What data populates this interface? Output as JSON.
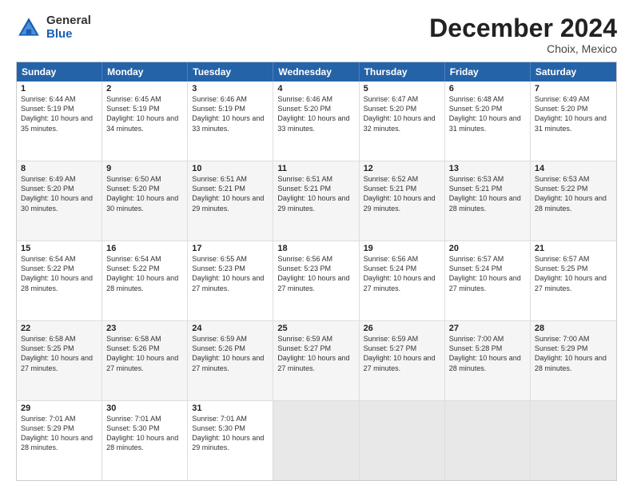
{
  "logo": {
    "general": "General",
    "blue": "Blue"
  },
  "title": "December 2024",
  "subtitle": "Choix, Mexico",
  "days_of_week": [
    "Sunday",
    "Monday",
    "Tuesday",
    "Wednesday",
    "Thursday",
    "Friday",
    "Saturday"
  ],
  "weeks": [
    [
      {
        "day": "1",
        "sunrise": "Sunrise: 6:44 AM",
        "sunset": "Sunset: 5:19 PM",
        "daylight": "Daylight: 10 hours and 35 minutes."
      },
      {
        "day": "2",
        "sunrise": "Sunrise: 6:45 AM",
        "sunset": "Sunset: 5:19 PM",
        "daylight": "Daylight: 10 hours and 34 minutes."
      },
      {
        "day": "3",
        "sunrise": "Sunrise: 6:46 AM",
        "sunset": "Sunset: 5:19 PM",
        "daylight": "Daylight: 10 hours and 33 minutes."
      },
      {
        "day": "4",
        "sunrise": "Sunrise: 6:46 AM",
        "sunset": "Sunset: 5:20 PM",
        "daylight": "Daylight: 10 hours and 33 minutes."
      },
      {
        "day": "5",
        "sunrise": "Sunrise: 6:47 AM",
        "sunset": "Sunset: 5:20 PM",
        "daylight": "Daylight: 10 hours and 32 minutes."
      },
      {
        "day": "6",
        "sunrise": "Sunrise: 6:48 AM",
        "sunset": "Sunset: 5:20 PM",
        "daylight": "Daylight: 10 hours and 31 minutes."
      },
      {
        "day": "7",
        "sunrise": "Sunrise: 6:49 AM",
        "sunset": "Sunset: 5:20 PM",
        "daylight": "Daylight: 10 hours and 31 minutes."
      }
    ],
    [
      {
        "day": "8",
        "sunrise": "Sunrise: 6:49 AM",
        "sunset": "Sunset: 5:20 PM",
        "daylight": "Daylight: 10 hours and 30 minutes."
      },
      {
        "day": "9",
        "sunrise": "Sunrise: 6:50 AM",
        "sunset": "Sunset: 5:20 PM",
        "daylight": "Daylight: 10 hours and 30 minutes."
      },
      {
        "day": "10",
        "sunrise": "Sunrise: 6:51 AM",
        "sunset": "Sunset: 5:21 PM",
        "daylight": "Daylight: 10 hours and 29 minutes."
      },
      {
        "day": "11",
        "sunrise": "Sunrise: 6:51 AM",
        "sunset": "Sunset: 5:21 PM",
        "daylight": "Daylight: 10 hours and 29 minutes."
      },
      {
        "day": "12",
        "sunrise": "Sunrise: 6:52 AM",
        "sunset": "Sunset: 5:21 PM",
        "daylight": "Daylight: 10 hours and 29 minutes."
      },
      {
        "day": "13",
        "sunrise": "Sunrise: 6:53 AM",
        "sunset": "Sunset: 5:21 PM",
        "daylight": "Daylight: 10 hours and 28 minutes."
      },
      {
        "day": "14",
        "sunrise": "Sunrise: 6:53 AM",
        "sunset": "Sunset: 5:22 PM",
        "daylight": "Daylight: 10 hours and 28 minutes."
      }
    ],
    [
      {
        "day": "15",
        "sunrise": "Sunrise: 6:54 AM",
        "sunset": "Sunset: 5:22 PM",
        "daylight": "Daylight: 10 hours and 28 minutes."
      },
      {
        "day": "16",
        "sunrise": "Sunrise: 6:54 AM",
        "sunset": "Sunset: 5:22 PM",
        "daylight": "Daylight: 10 hours and 28 minutes."
      },
      {
        "day": "17",
        "sunrise": "Sunrise: 6:55 AM",
        "sunset": "Sunset: 5:23 PM",
        "daylight": "Daylight: 10 hours and 27 minutes."
      },
      {
        "day": "18",
        "sunrise": "Sunrise: 6:56 AM",
        "sunset": "Sunset: 5:23 PM",
        "daylight": "Daylight: 10 hours and 27 minutes."
      },
      {
        "day": "19",
        "sunrise": "Sunrise: 6:56 AM",
        "sunset": "Sunset: 5:24 PM",
        "daylight": "Daylight: 10 hours and 27 minutes."
      },
      {
        "day": "20",
        "sunrise": "Sunrise: 6:57 AM",
        "sunset": "Sunset: 5:24 PM",
        "daylight": "Daylight: 10 hours and 27 minutes."
      },
      {
        "day": "21",
        "sunrise": "Sunrise: 6:57 AM",
        "sunset": "Sunset: 5:25 PM",
        "daylight": "Daylight: 10 hours and 27 minutes."
      }
    ],
    [
      {
        "day": "22",
        "sunrise": "Sunrise: 6:58 AM",
        "sunset": "Sunset: 5:25 PM",
        "daylight": "Daylight: 10 hours and 27 minutes."
      },
      {
        "day": "23",
        "sunrise": "Sunrise: 6:58 AM",
        "sunset": "Sunset: 5:26 PM",
        "daylight": "Daylight: 10 hours and 27 minutes."
      },
      {
        "day": "24",
        "sunrise": "Sunrise: 6:59 AM",
        "sunset": "Sunset: 5:26 PM",
        "daylight": "Daylight: 10 hours and 27 minutes."
      },
      {
        "day": "25",
        "sunrise": "Sunrise: 6:59 AM",
        "sunset": "Sunset: 5:27 PM",
        "daylight": "Daylight: 10 hours and 27 minutes."
      },
      {
        "day": "26",
        "sunrise": "Sunrise: 6:59 AM",
        "sunset": "Sunset: 5:27 PM",
        "daylight": "Daylight: 10 hours and 27 minutes."
      },
      {
        "day": "27",
        "sunrise": "Sunrise: 7:00 AM",
        "sunset": "Sunset: 5:28 PM",
        "daylight": "Daylight: 10 hours and 28 minutes."
      },
      {
        "day": "28",
        "sunrise": "Sunrise: 7:00 AM",
        "sunset": "Sunset: 5:29 PM",
        "daylight": "Daylight: 10 hours and 28 minutes."
      }
    ],
    [
      {
        "day": "29",
        "sunrise": "Sunrise: 7:01 AM",
        "sunset": "Sunset: 5:29 PM",
        "daylight": "Daylight: 10 hours and 28 minutes."
      },
      {
        "day": "30",
        "sunrise": "Sunrise: 7:01 AM",
        "sunset": "Sunset: 5:30 PM",
        "daylight": "Daylight: 10 hours and 28 minutes."
      },
      {
        "day": "31",
        "sunrise": "Sunrise: 7:01 AM",
        "sunset": "Sunset: 5:30 PM",
        "daylight": "Daylight: 10 hours and 29 minutes."
      },
      null,
      null,
      null,
      null
    ]
  ]
}
